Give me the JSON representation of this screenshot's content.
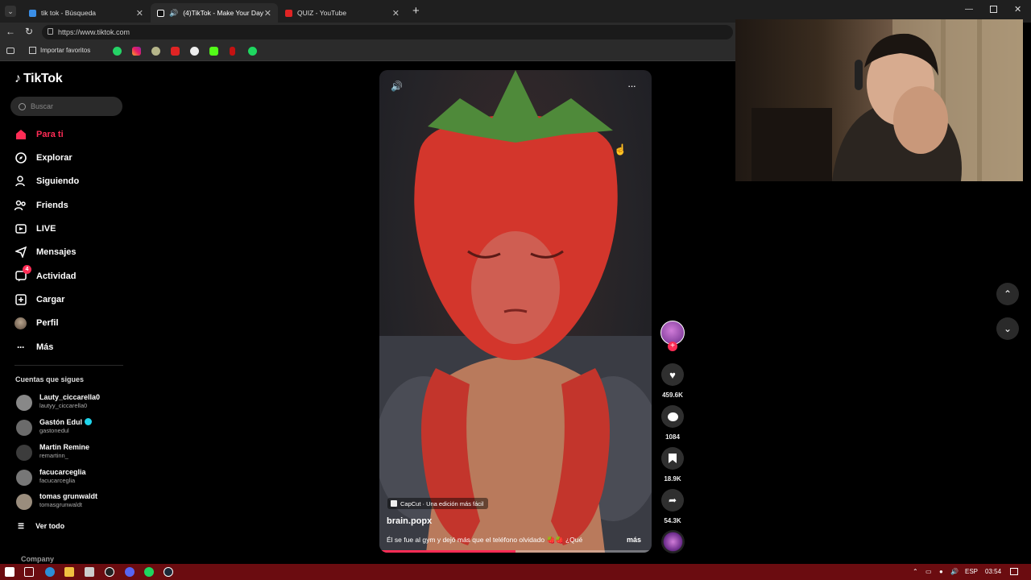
{
  "browser": {
    "tabs": [
      {
        "label": "tik tok - Búsqueda"
      },
      {
        "label": "(4)TikTok - Make Your Day"
      },
      {
        "label": "QUIZ - YouTube"
      }
    ],
    "url": "https://www.tiktok.com",
    "import_favorites": "Importar favoritos"
  },
  "sidebar": {
    "logo": "TikTok",
    "search_placeholder": "Buscar",
    "nav": [
      {
        "label": "Para ti",
        "icon": "home-icon"
      },
      {
        "label": "Explorar",
        "icon": "compass-icon"
      },
      {
        "label": "Siguiendo",
        "icon": "user-follow-icon"
      },
      {
        "label": "Friends",
        "icon": "friends-icon"
      },
      {
        "label": "LIVE",
        "icon": "live-icon"
      },
      {
        "label": "Mensajes",
        "icon": "paper-plane-icon"
      },
      {
        "label": "Actividad",
        "icon": "activity-icon",
        "badge": "4"
      },
      {
        "label": "Cargar",
        "icon": "upload-icon"
      },
      {
        "label": "Perfil",
        "icon": "avatar-icon"
      },
      {
        "label": "Más",
        "icon": "more-icon"
      }
    ],
    "following_title": "Cuentas que sigues",
    "following": [
      {
        "name": "Lauty_ciccarella0",
        "handle": "lautyy_ciccarella0"
      },
      {
        "name": "Gastón Edul",
        "handle": "gastonedul",
        "verified": true
      },
      {
        "name": "Martin Remine",
        "handle": "remartinn_"
      },
      {
        "name": "facucarceglia",
        "handle": "facucarceglia"
      },
      {
        "name": "tomas grunwaldt",
        "handle": "tomasgrunwaldt"
      }
    ],
    "see_all": "Ver todo",
    "company": "Company"
  },
  "video": {
    "capcut": "CapCut · Una edición más fácil",
    "author": "brain.popx",
    "caption": "Él se fue al gym y dejó más que el teléfono olvidado 🍓🍓 ¿Qué",
    "more": "más",
    "progress": 0.5
  },
  "actions": {
    "likes": "459.6K",
    "comments": "1084",
    "saves": "18.9K",
    "shares": "54.3K"
  },
  "taskbar": {
    "lang": "ESP",
    "time": "03:54"
  },
  "colors": {
    "accent": "#fe2c55",
    "taskbar": "#6b0c10"
  }
}
